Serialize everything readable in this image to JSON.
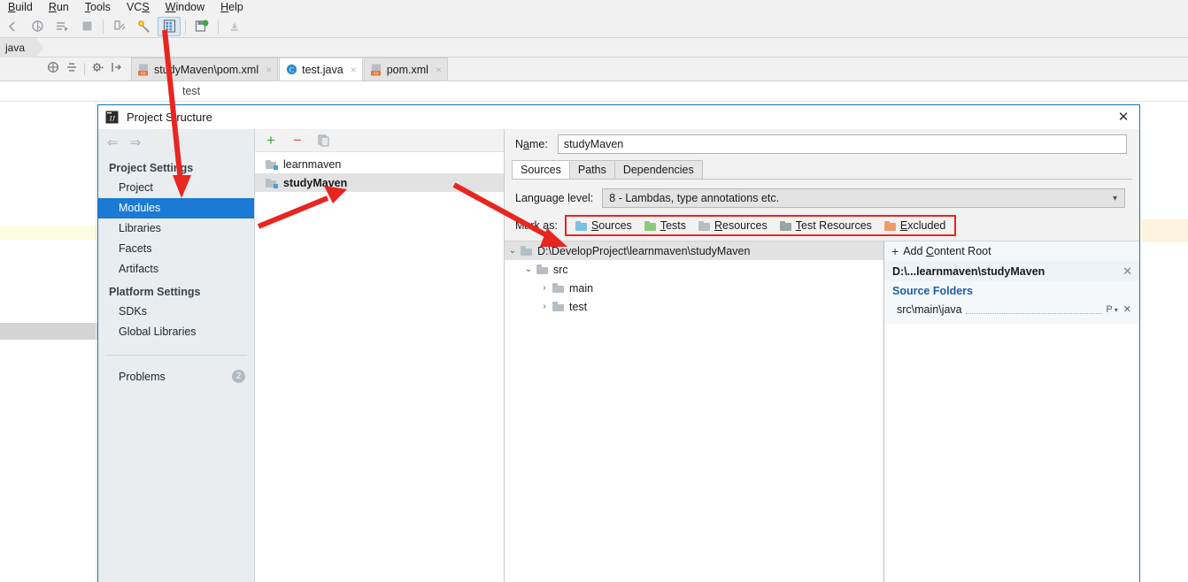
{
  "ide": {
    "menubar": [
      "Build",
      "Run",
      "Tools",
      "VCS",
      "Window",
      "Help"
    ],
    "menubar_mnemonics": [
      "B",
      "R",
      "T",
      "S",
      "W",
      "H"
    ],
    "breadcrumb": "java",
    "editor_tabs": [
      {
        "label": "studyMaven\\pom.xml",
        "icon": "xml-file-icon",
        "active": false,
        "close": "×"
      },
      {
        "label": "test.java",
        "icon": "java-class-icon",
        "active": true,
        "close": "×"
      },
      {
        "label": "pom.xml",
        "icon": "xml-file-icon",
        "active": false,
        "close": "×"
      }
    ],
    "structure_label": "test",
    "toolbar_icons": [
      "back-icon",
      "debug-icon",
      "run-with-coverage-icon",
      "stop-icon",
      "separator",
      "build-project-icon",
      "settings-wrench-icon",
      "project-structure-icon",
      "separator",
      "sync-maven-icon",
      "separator",
      "ide-scripting-icon"
    ]
  },
  "dialog": {
    "title": "Project Structure",
    "title_icon": "intellij-idea-icon",
    "close_label": "✕",
    "sidebar": {
      "nav_back": "⇐",
      "nav_forward": "⇒",
      "groups": [
        {
          "title": "Project Settings",
          "items": [
            "Project",
            "Modules",
            "Libraries",
            "Facets",
            "Artifacts"
          ],
          "selected": "Modules"
        },
        {
          "title": "Platform Settings",
          "items": [
            "SDKs",
            "Global Libraries"
          ],
          "selected": null
        }
      ],
      "problems": {
        "label": "Problems",
        "count": "2"
      }
    },
    "modules": {
      "toolbar": [
        {
          "name": "add-module-button",
          "glyph": "+",
          "color": "#3aa63a"
        },
        {
          "name": "remove-module-button",
          "glyph": "−",
          "color": "#d9534f"
        },
        {
          "name": "copy-module-button",
          "glyph": "❐",
          "color": "#8a9198"
        }
      ],
      "items": [
        {
          "label": "learnmaven",
          "selected": false
        },
        {
          "label": "studyMaven",
          "selected": true
        }
      ]
    },
    "detail": {
      "name_label": "Name:",
      "name_mnemonic": "a",
      "name_value": "studyMaven",
      "tabs": [
        {
          "label": "Sources",
          "active": true
        },
        {
          "label": "Paths",
          "active": false
        },
        {
          "label": "Dependencies",
          "active": false
        }
      ],
      "language_level_label": "Language level:",
      "language_level_value": "8 - Lambdas, type annotations etc.",
      "language_level_caret": "▾",
      "mark_as_label": "Mark as:",
      "mark_as_options": [
        {
          "label": "Sources",
          "mnemonic": "S",
          "color": "#79c2e0"
        },
        {
          "label": "Tests",
          "mnemonic": "T",
          "color": "#8cc97e"
        },
        {
          "label": "Resources",
          "mnemonic": "R",
          "color": "#b6bdc3"
        },
        {
          "label": "Test Resources",
          "mnemonic": "T",
          "color": "#9aa59b"
        },
        {
          "label": "Excluded",
          "mnemonic": "E",
          "color": "#ef9a6a"
        }
      ],
      "highlight_color": "#e8251f",
      "tree": [
        {
          "label": "D:\\DevelopProject\\learnmaven\\studyMaven",
          "depth": 0,
          "twisty": "⌄",
          "selected": true
        },
        {
          "label": "src",
          "depth": 1,
          "twisty": "⌄",
          "selected": false
        },
        {
          "label": "main",
          "depth": 2,
          "twisty": "›",
          "selected": false
        },
        {
          "label": "test",
          "depth": 2,
          "twisty": "›",
          "selected": false
        }
      ],
      "right_panel": {
        "add_content_root": "Add Content Root",
        "add_plus": "+",
        "content_root": "D:\\...learnmaven\\studyMaven",
        "content_root_close": "✕",
        "source_folders_title": "Source Folders",
        "source_folders": [
          {
            "path": "src\\main\\java",
            "package_icon": "package-prefix-icon",
            "remove": "✕"
          }
        ]
      }
    }
  },
  "colors": {
    "accent_blue": "#1a7ad4",
    "annotation_red": "#e8251f",
    "dialog_border": "#1a74a8",
    "link_blue": "#1a5fa8"
  }
}
